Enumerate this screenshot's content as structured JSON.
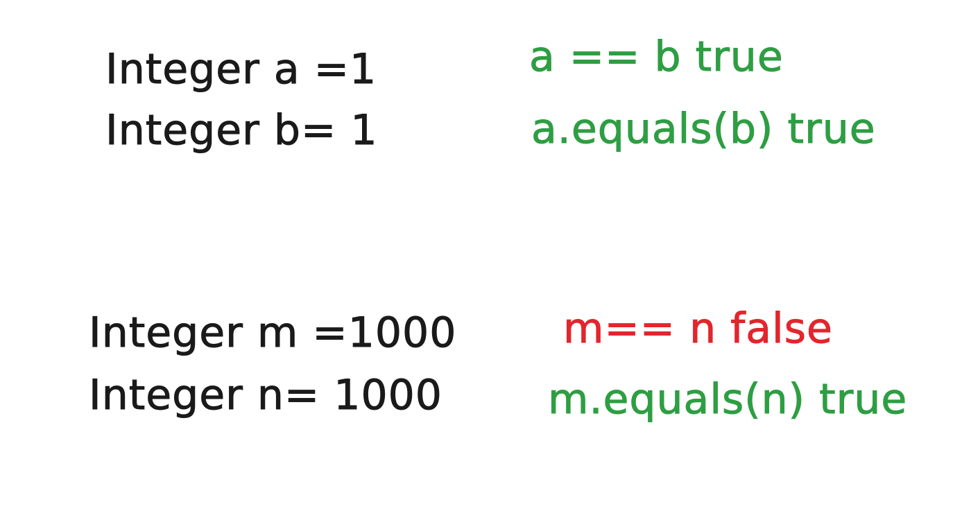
{
  "colors": {
    "code": "#1a1a1a",
    "true_result": "#2e9e43",
    "false_result": "#e3252d"
  },
  "small_case": {
    "declarations": [
      "Integer a =1",
      "Integer b= 1"
    ],
    "results": [
      {
        "text": "a == b true",
        "status": "true"
      },
      {
        "text": "a.equals(b) true",
        "status": "true"
      }
    ]
  },
  "large_case": {
    "declarations": [
      "Integer m =1000",
      "Integer n= 1000"
    ],
    "results": [
      {
        "text": "m== n false",
        "status": "false"
      },
      {
        "text": "m.equals(n) true",
        "status": "true"
      }
    ]
  }
}
